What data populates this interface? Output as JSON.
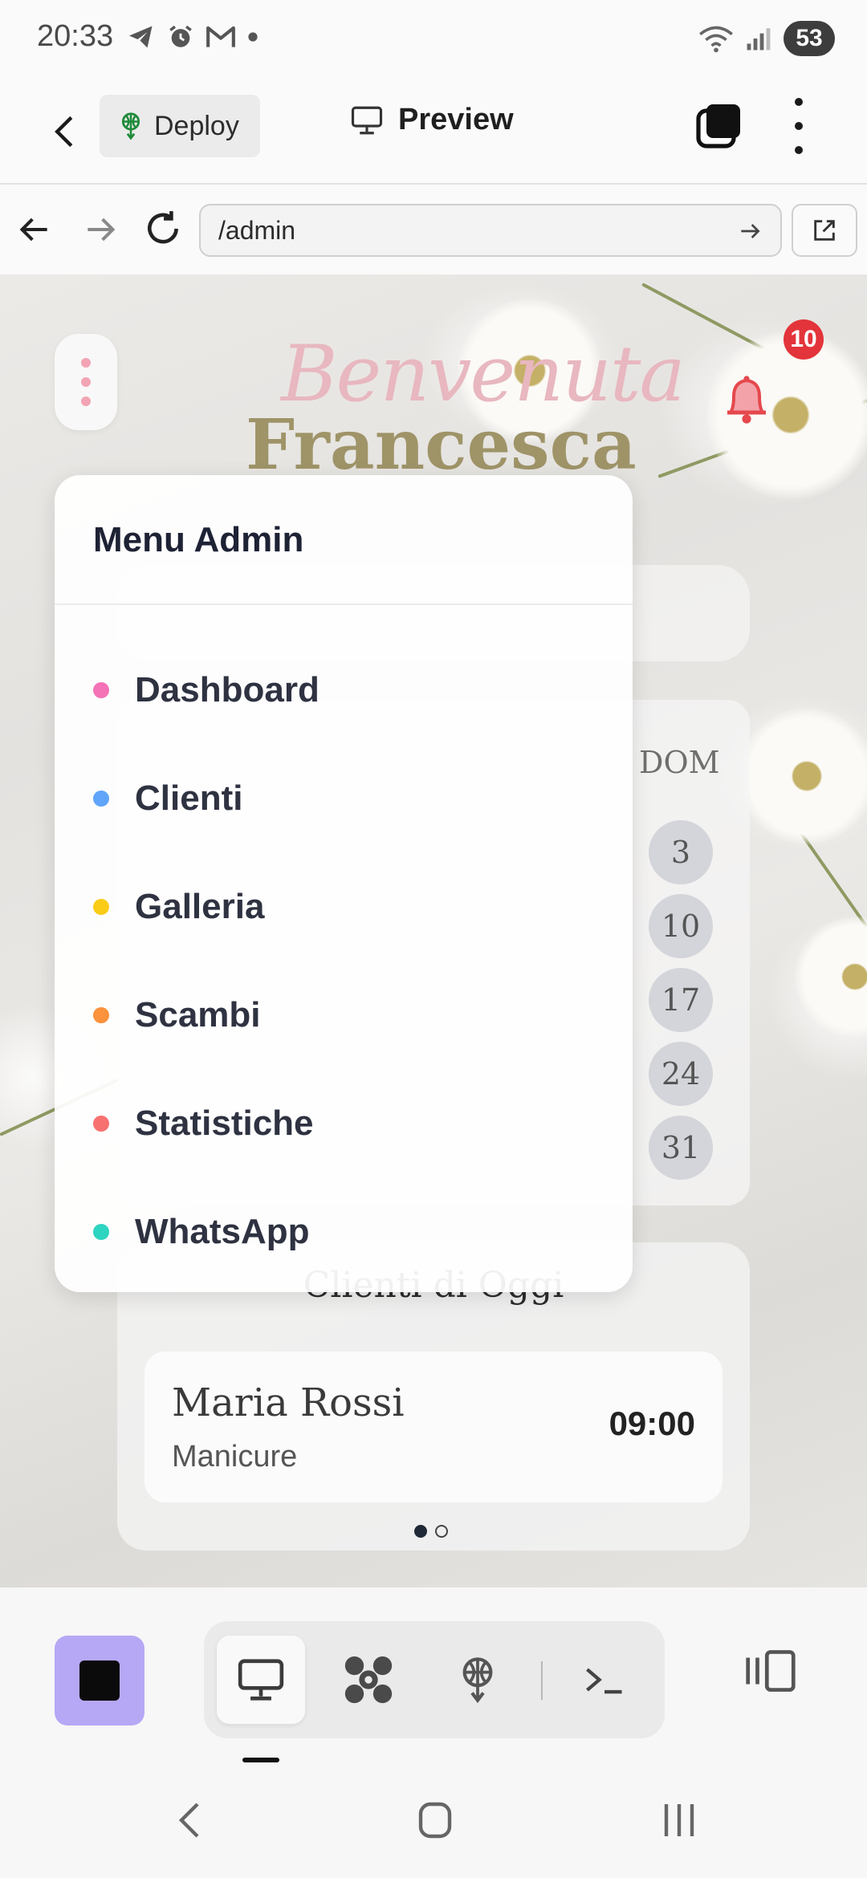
{
  "status_bar": {
    "time": "20:33",
    "battery": "53",
    "icons": [
      "telegram-icon",
      "alarm-icon",
      "gmail-icon",
      "dot-icon",
      "wifi-icon",
      "signal-icon"
    ]
  },
  "toolbar": {
    "deploy_label": "Deploy",
    "preview_label": "Preview"
  },
  "url_bar": {
    "url": "/admin"
  },
  "page": {
    "welcome_script": "Benvenuta",
    "welcome_name": "Francesca",
    "notification_count": "10",
    "calendar": {
      "day_header": "DOM",
      "days": [
        "3",
        "10",
        "17",
        "24",
        "31"
      ]
    },
    "clients_today": {
      "title": "Clienti di Oggi",
      "items": [
        {
          "name": "Maria Rossi",
          "service": "Manicure",
          "time": "09:00"
        }
      ],
      "pages": 2,
      "active_page": 0
    }
  },
  "admin_menu": {
    "title": "Menu Admin",
    "items": [
      {
        "label": "Dashboard",
        "color": "#f472b6"
      },
      {
        "label": "Clienti",
        "color": "#60a5fa"
      },
      {
        "label": "Galleria",
        "color": "#facc15"
      },
      {
        "label": "Scambi",
        "color": "#fb923c"
      },
      {
        "label": "Statistiche",
        "color": "#f87171"
      },
      {
        "label": "WhatsApp",
        "color": "#2dd4bf"
      }
    ]
  },
  "colors": {
    "accent": "#b6a8f5",
    "badge": "#e3343b",
    "welcome_pink": "#e8b7bf",
    "welcome_gold": "#9f9468"
  }
}
